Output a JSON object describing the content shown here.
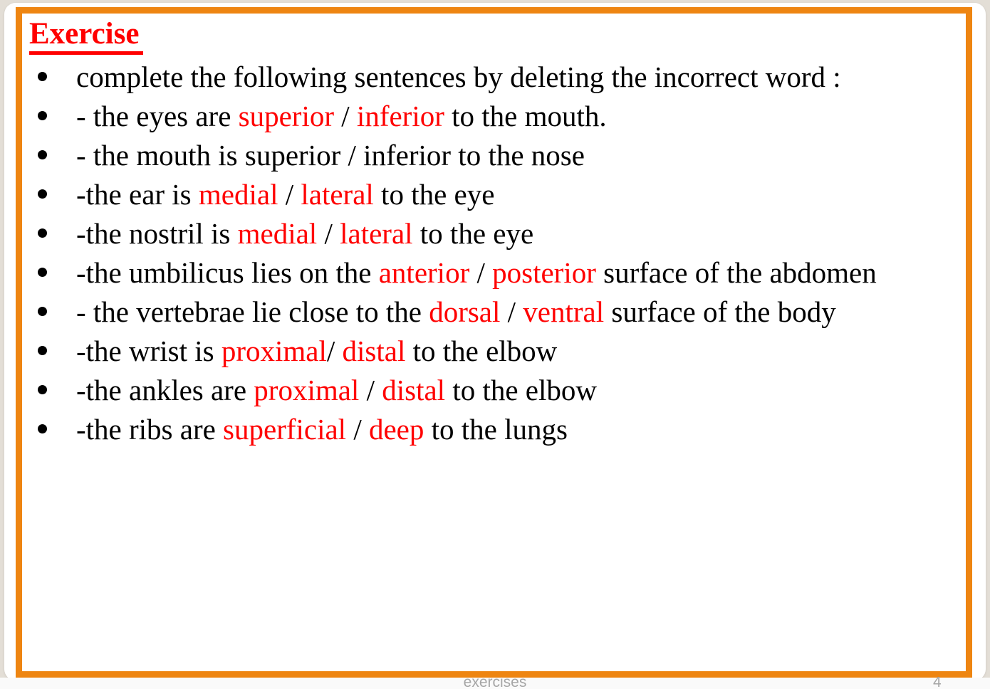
{
  "slide": {
    "title": "Exercise",
    "footer_label": "exercises",
    "page_number": "4",
    "accent_color": "#ee8511",
    "highlight_color": "#ff0000",
    "text_color": "#000000",
    "background_color": "#e3ded6",
    "panel_color": "#ffffff",
    "footer_color": "#a6a6a6"
  },
  "bullets": [
    {
      "segments": [
        {
          "text": "complete the following sentences by deleting the incorrect word :",
          "color": "black"
        }
      ]
    },
    {
      "segments": [
        {
          "text": "- the eyes are ",
          "color": "black"
        },
        {
          "text": "superior",
          "color": "red"
        },
        {
          "text": " / ",
          "color": "black"
        },
        {
          "text": "inferior",
          "color": "red"
        },
        {
          "text": " to the mouth.",
          "color": "black"
        }
      ]
    },
    {
      "segments": [
        {
          "text": "- the mouth is superior / inferior to the nose",
          "color": "black"
        }
      ]
    },
    {
      "segments": [
        {
          "text": "-the ear is ",
          "color": "black"
        },
        {
          "text": "medial",
          "color": "red"
        },
        {
          "text": " / ",
          "color": "black"
        },
        {
          "text": "lateral",
          "color": "red"
        },
        {
          "text": " to the eye",
          "color": "black"
        }
      ]
    },
    {
      "segments": [
        {
          "text": "-the nostril is ",
          "color": "black"
        },
        {
          "text": "medial",
          "color": "red"
        },
        {
          "text": " / ",
          "color": "black"
        },
        {
          "text": "lateral",
          "color": "red"
        },
        {
          "text": " to the eye",
          "color": "black"
        }
      ]
    },
    {
      "segments": [
        {
          "text": "-the umbilicus lies on the ",
          "color": "black"
        },
        {
          "text": "anterior",
          "color": "red"
        },
        {
          "text": " / ",
          "color": "black"
        },
        {
          "text": "posterior",
          "color": "red"
        },
        {
          "text": " surface of the abdomen",
          "color": "black"
        }
      ]
    },
    {
      "segments": [
        {
          "text": "- the vertebrae lie close to the ",
          "color": "black"
        },
        {
          "text": "dorsal",
          "color": "red"
        },
        {
          "text": " / ",
          "color": "black"
        },
        {
          "text": "ventral",
          "color": "red"
        },
        {
          "text": " surface of the body",
          "color": "black"
        }
      ]
    },
    {
      "segments": [
        {
          "text": "-the wrist is ",
          "color": "black"
        },
        {
          "text": "proximal",
          "color": "red"
        },
        {
          "text": "/ ",
          "color": "black"
        },
        {
          "text": "distal",
          "color": "red"
        },
        {
          "text": " to the elbow",
          "color": "black"
        }
      ]
    },
    {
      "segments": [
        {
          "text": "-the ankles are ",
          "color": "black"
        },
        {
          "text": "proximal",
          "color": "red"
        },
        {
          "text": " / ",
          "color": "black"
        },
        {
          "text": "distal",
          "color": "red"
        },
        {
          "text": " to the elbow",
          "color": "black"
        }
      ]
    },
    {
      "segments": [
        {
          "text": "-the ribs are ",
          "color": "black"
        },
        {
          "text": "superficial",
          "color": "red"
        },
        {
          "text": " / ",
          "color": "black"
        },
        {
          "text": "deep",
          "color": "red"
        },
        {
          "text": " to the lungs",
          "color": "black"
        }
      ]
    }
  ]
}
